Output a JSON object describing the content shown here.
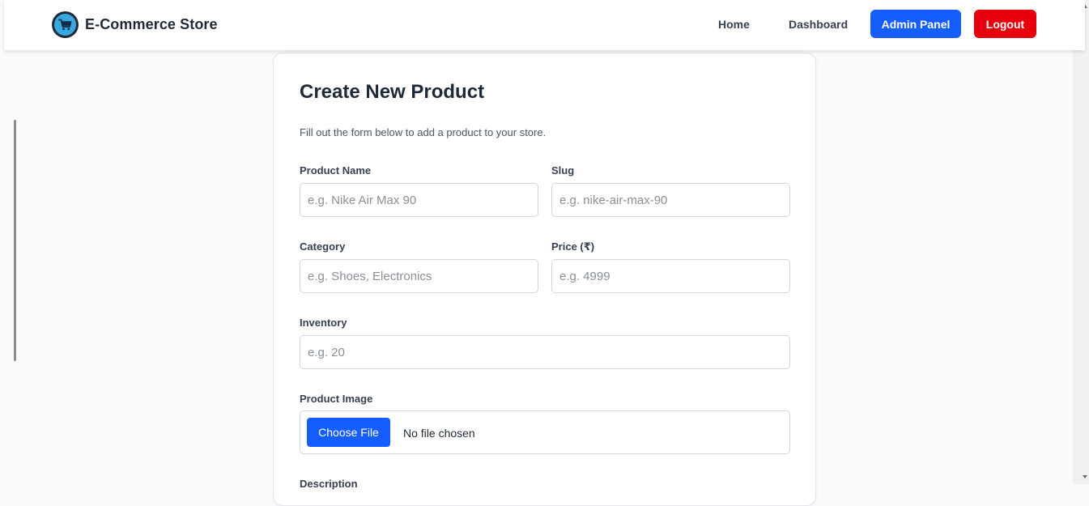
{
  "header": {
    "brand_name": "E-Commerce Store",
    "brand_icon": "shopping-cart-icon",
    "nav": {
      "home": "Home",
      "dashboard": "Dashboard",
      "admin_panel": "Admin Panel",
      "logout": "Logout"
    },
    "colors": {
      "admin": "#155dfc",
      "logout": "#e7000b"
    }
  },
  "form": {
    "title": "Create New Product",
    "subtitle": "Fill out the form below to add a product to your store.",
    "fields": {
      "product_name": {
        "label": "Product Name",
        "placeholder": "e.g. Nike Air Max 90",
        "value": ""
      },
      "slug": {
        "label": "Slug",
        "placeholder": "e.g. nike-air-max-90",
        "value": ""
      },
      "category": {
        "label": "Category",
        "placeholder": "e.g. Shoes, Electronics",
        "value": ""
      },
      "price": {
        "label": "Price (₹)",
        "placeholder": "e.g. 4999",
        "value": ""
      },
      "inventory": {
        "label": "Inventory",
        "placeholder": "e.g. 20",
        "value": ""
      },
      "product_image": {
        "label": "Product Image",
        "button": "Choose File",
        "status": "No file chosen"
      },
      "description": {
        "label": "Description"
      }
    }
  }
}
